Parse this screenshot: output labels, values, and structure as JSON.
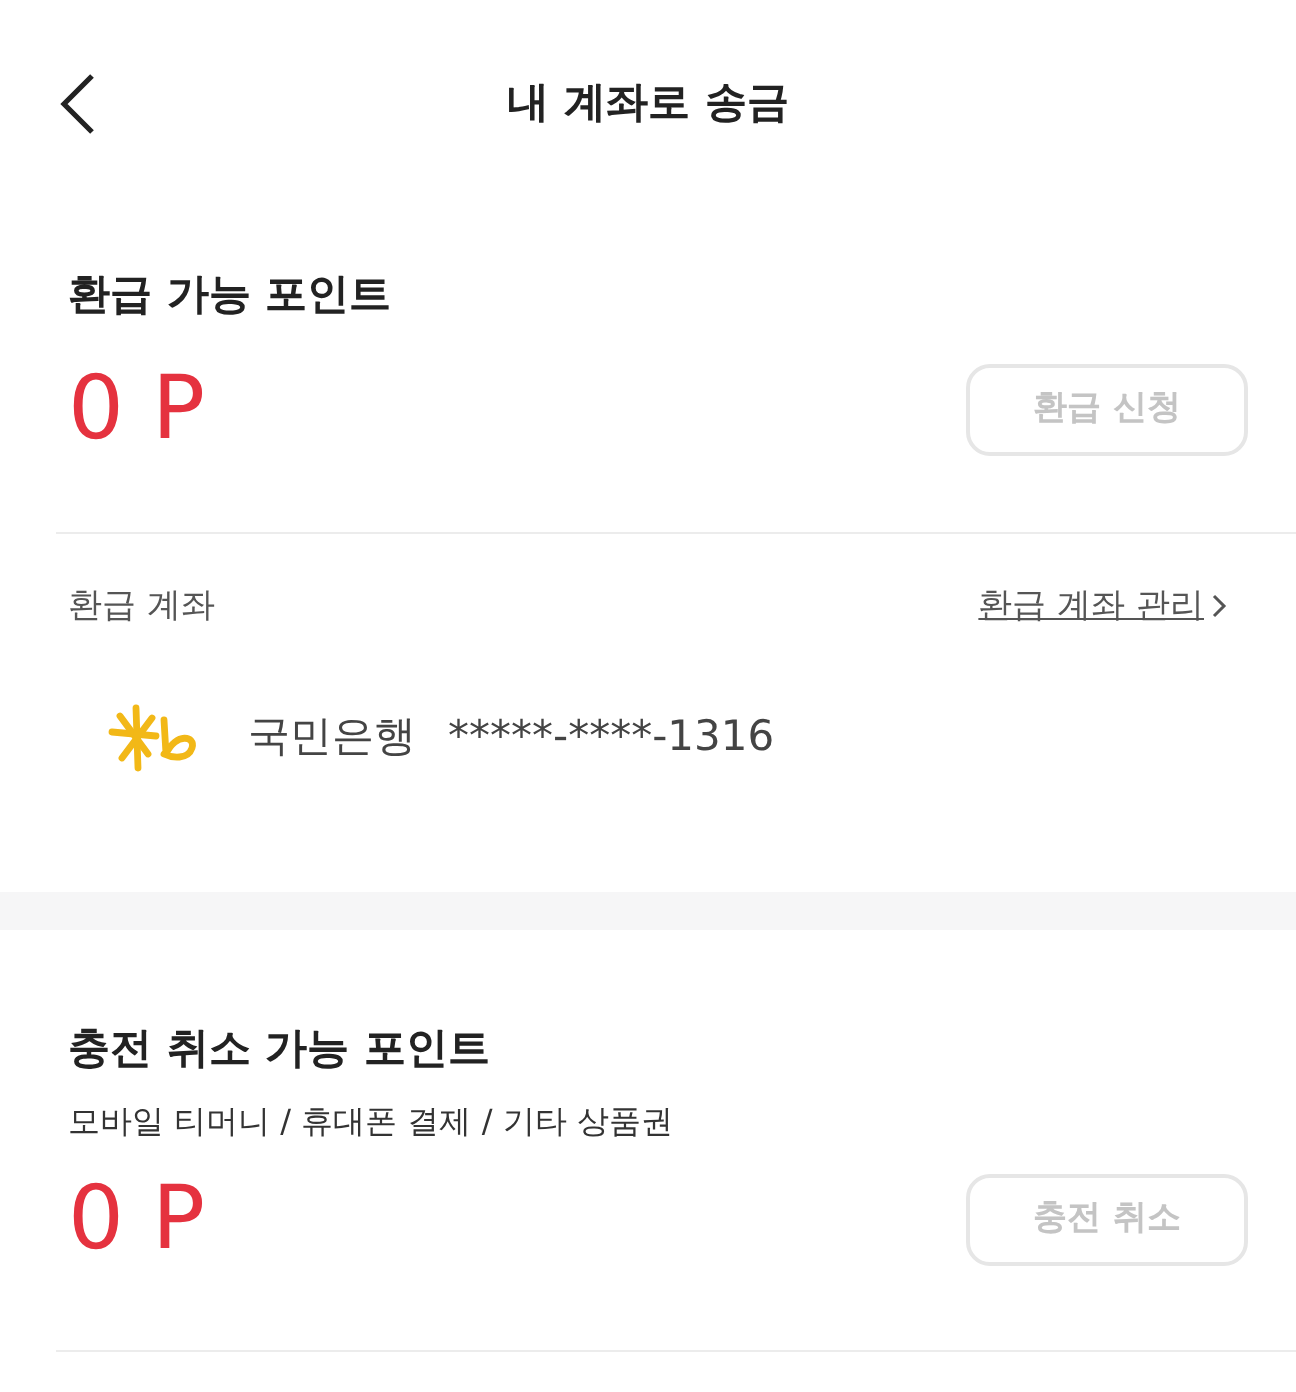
{
  "header": {
    "title": "내 계좌로 송금"
  },
  "sections": [
    {
      "title": "환급 가능 포인트",
      "amount": "0 P",
      "button": {
        "label": "환급 신청",
        "disabled": true
      },
      "account": {
        "label": "환급 계좌",
        "manage_link": "환급 계좌 관리",
        "bank_name": "국민은행",
        "account_number": "*****-****-1316"
      }
    },
    {
      "title": "충전 취소 가능 포인트",
      "subtitle": "모바일 티머니 / 휴대폰 결제 / 기타 상품권",
      "amount": "0 P",
      "button": {
        "label": "충전 취소",
        "disabled": true
      }
    }
  ]
}
